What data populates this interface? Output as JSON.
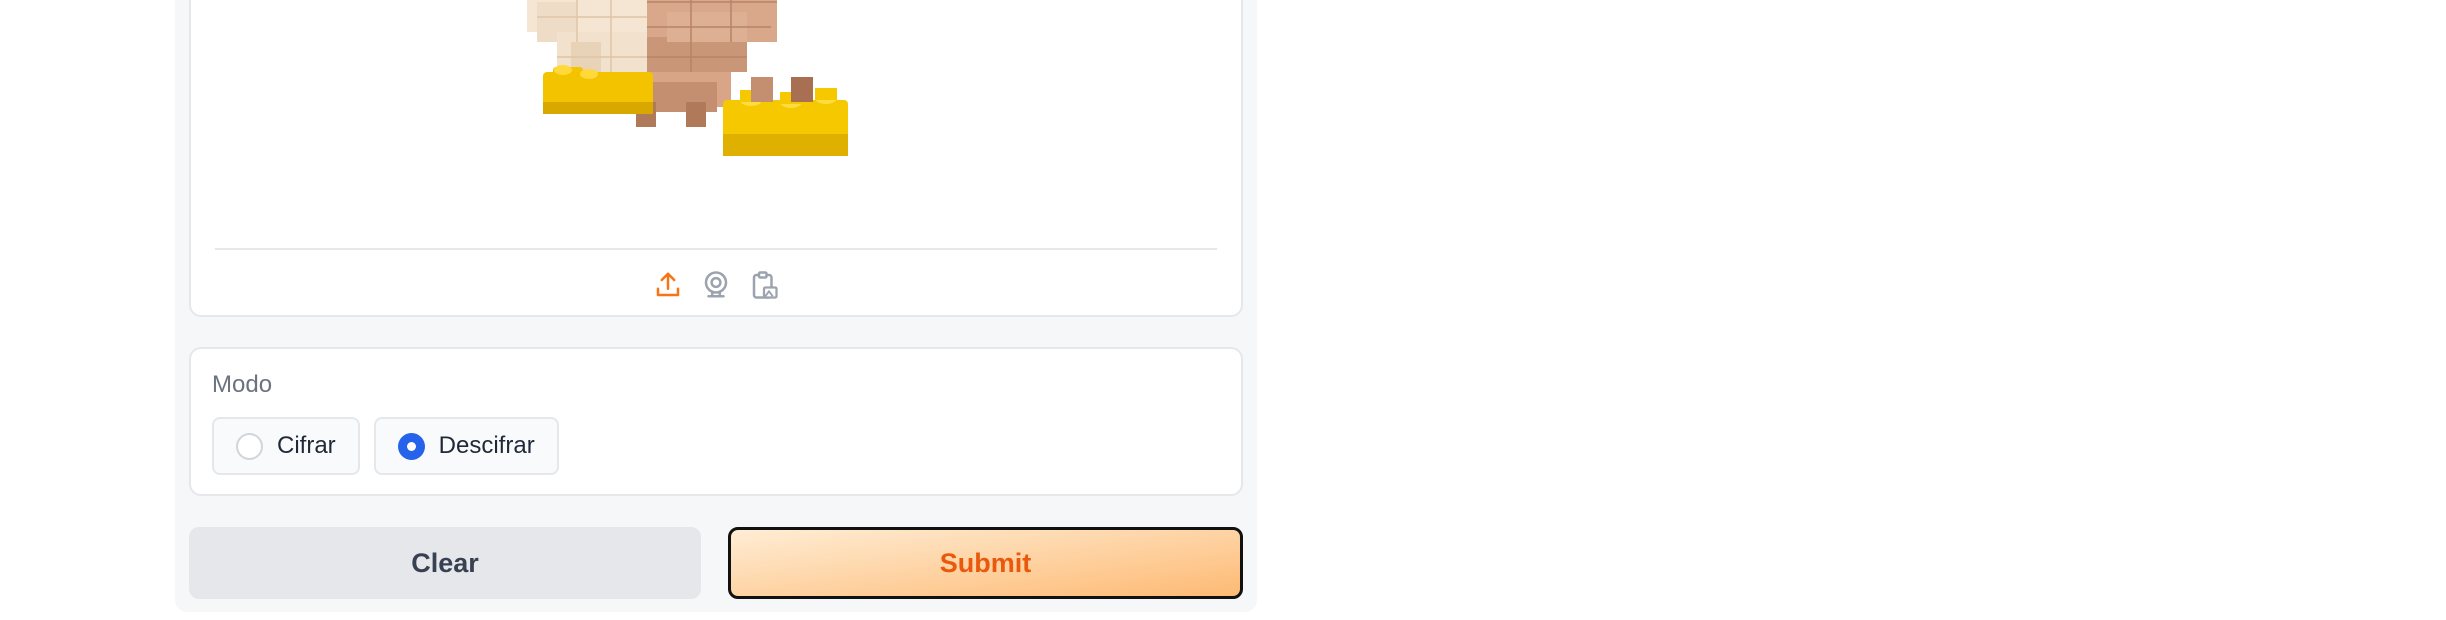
{
  "image_input": {
    "image_description_icon": "lego-duck-figure",
    "sources": [
      {
        "icon": "upload-icon",
        "color": "#f97316",
        "active": true
      },
      {
        "icon": "webcam-icon",
        "color": "#9ca3af",
        "active": false
      },
      {
        "icon": "clipboard-icon",
        "color": "#9ca3af",
        "active": false
      }
    ]
  },
  "mode": {
    "label": "Modo",
    "options": [
      {
        "label": "Cifrar",
        "checked": false
      },
      {
        "label": "Descifrar",
        "checked": true
      }
    ],
    "accent": "#2563eb"
  },
  "actions": {
    "clear_label": "Clear",
    "submit_label": "Submit",
    "submit_color": "#ea580c"
  }
}
